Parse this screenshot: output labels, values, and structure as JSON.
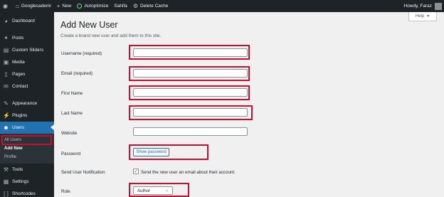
{
  "admin_bar": {
    "site_name": "Googlecademi",
    "new_label": "New",
    "autoptimize_label": "Autoptimize",
    "sahifa_label": "Sahifa",
    "delete_cache_label": "Delete Cache",
    "howdy": "Howdy, Faraz"
  },
  "sidebar": {
    "items": [
      {
        "label": "Dashboard",
        "icon": "dashboard-icon"
      },
      {
        "label": "Posts",
        "icon": "pin-icon"
      },
      {
        "label": "Custom Sliders",
        "icon": "slider-icon"
      },
      {
        "label": "Media",
        "icon": "media-icon"
      },
      {
        "label": "Pages",
        "icon": "page-icon"
      },
      {
        "label": "Contact",
        "icon": "mail-icon"
      },
      {
        "label": "Appearance",
        "icon": "brush-icon"
      },
      {
        "label": "Plugins",
        "icon": "plugin-icon"
      },
      {
        "label": "Users",
        "icon": "users-icon"
      },
      {
        "label": "Tools",
        "icon": "wrench-icon"
      },
      {
        "label": "Settings",
        "icon": "settings-icon"
      },
      {
        "label": "Shortcodes",
        "icon": "shortcode-icon"
      }
    ],
    "users_submenu": [
      "All Users",
      "Add New",
      "Profile"
    ]
  },
  "help_tab": "Help",
  "main": {
    "title": "Add New User",
    "description": "Create a brand new user and add them to this site.",
    "fields": {
      "username_label": "Username (required)",
      "email_label": "Email (required)",
      "first_name_label": "First Name",
      "last_name_label": "Last Name",
      "website_label": "Website",
      "password_label": "Password",
      "show_password": "Show password",
      "notification_label": "Send User Notification",
      "notification_text": "Send the new user an email about their account.",
      "role_label": "Role",
      "role_value": "Author"
    }
  },
  "colors": {
    "admin_dark": "#1d2327",
    "accent": "#2271b1",
    "highlight": "#c8102e"
  }
}
